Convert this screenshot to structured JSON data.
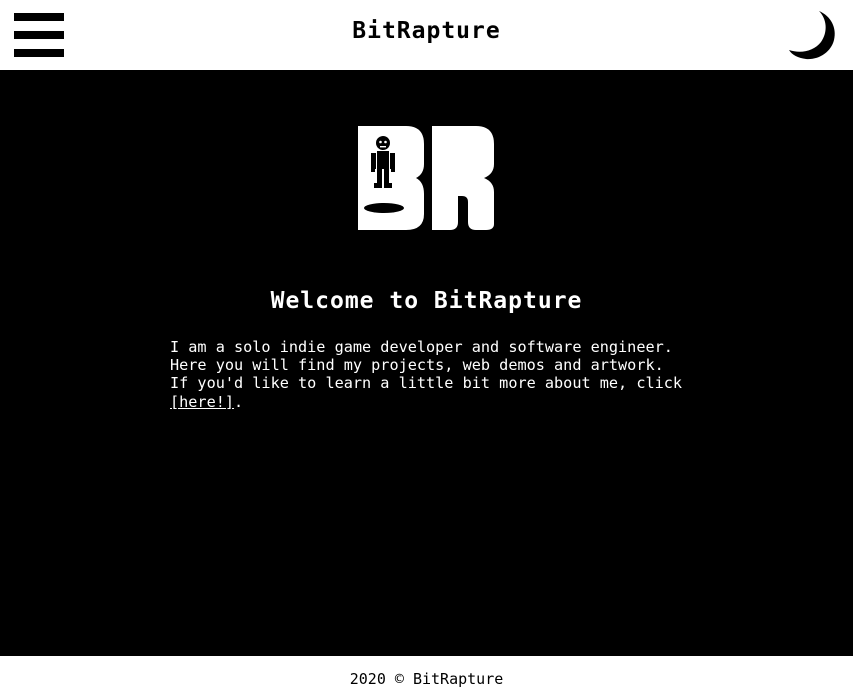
{
  "header": {
    "title": "BitRapture",
    "menu_icon": "hamburger-menu-icon",
    "theme_icon": "moon-icon"
  },
  "main": {
    "logo_letters": "BR",
    "heading": "Welcome to BitRapture",
    "intro": {
      "line1": "I am a solo indie game developer and software engineer.",
      "line2": "Here you will find my projects, web demos and artwork.",
      "line3": "If you'd like to learn a little bit more about me, click",
      "link": "[here!]",
      "after_link": "."
    }
  },
  "footer": {
    "copyright": "2020 © BitRapture"
  },
  "colors": {
    "background": "#000000",
    "header_bg": "#ffffff",
    "text_light": "#ffffff",
    "text_dark": "#000000"
  }
}
